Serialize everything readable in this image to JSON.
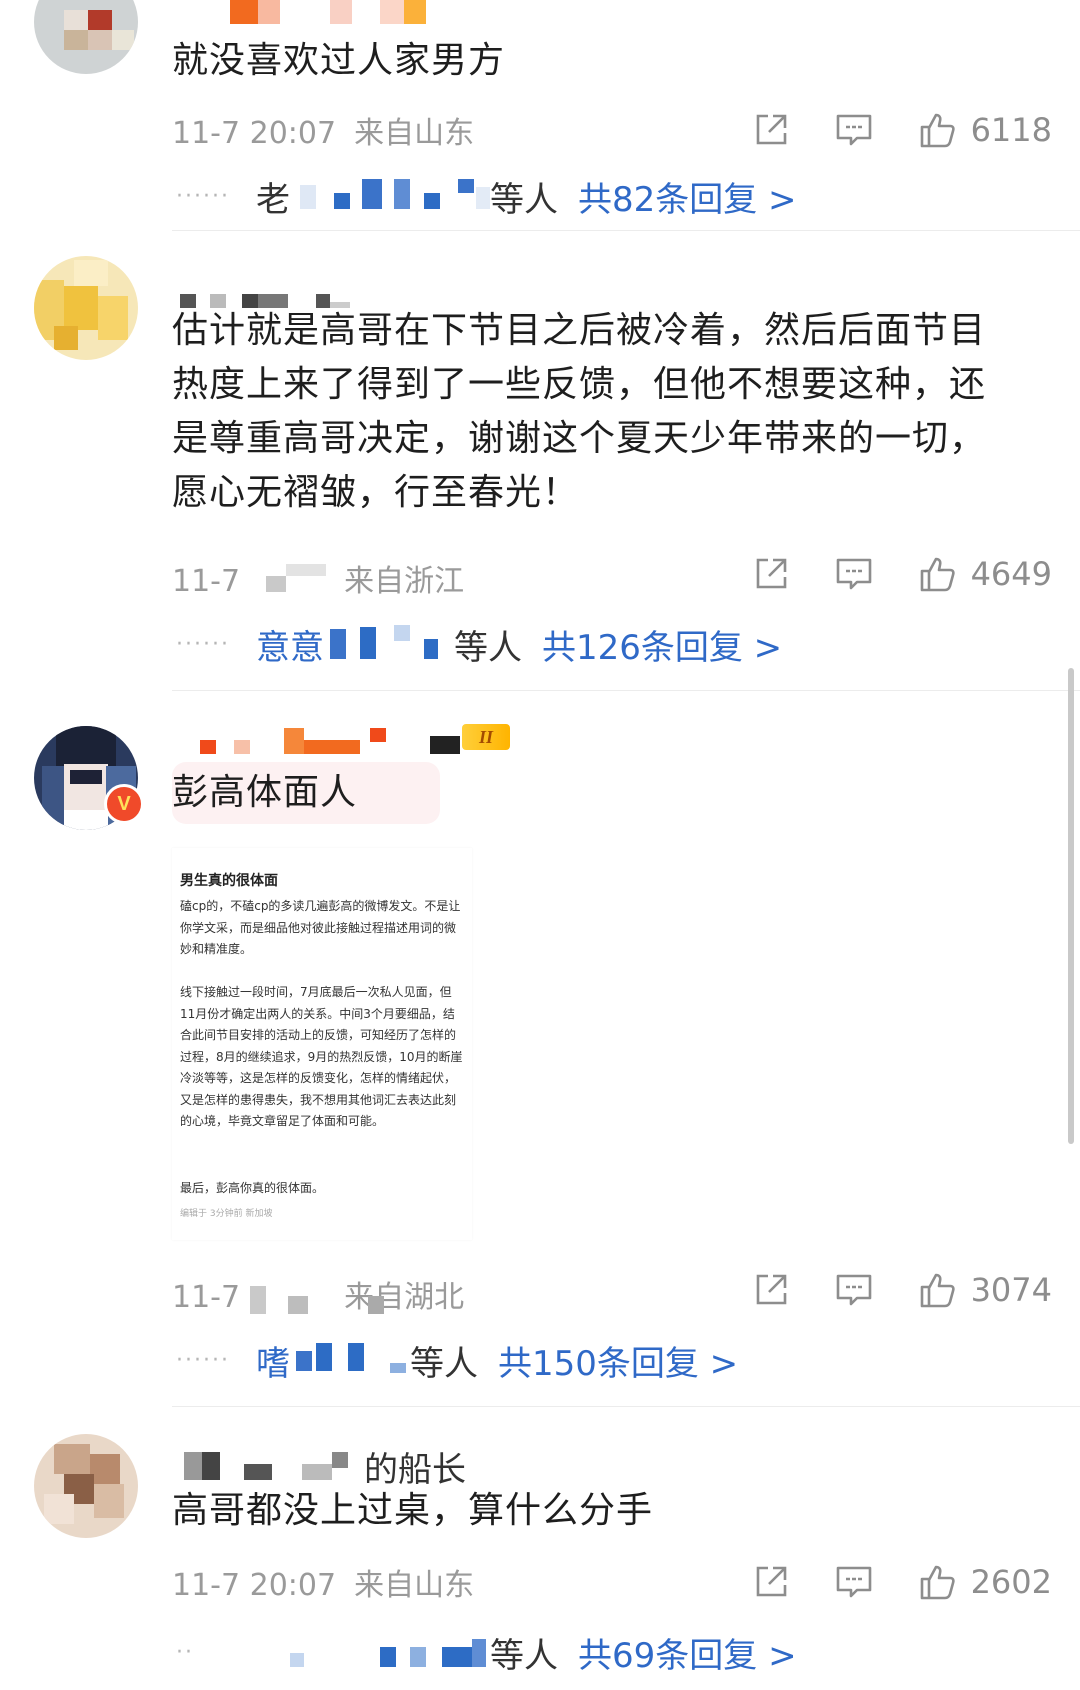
{
  "comments": [
    {
      "username": "",
      "text": "就没喜欢过人家男方",
      "time": "11-7 20:07",
      "location": "来自山东",
      "likes": "6118",
      "replies_prefix": "老",
      "replies_suffix": "等人",
      "replies_total": "共82条回复 >"
    },
    {
      "username": "",
      "text": "估计就是高哥在下节目之后被冷着，然后后面节目热度上来了得到了一些反馈，但他不想要这种，还是尊重高哥决定，谢谢这个夏天少年带来的一切，愿心无褶皱，行至春光！",
      "time": "11-7",
      "location": "来自浙江",
      "likes": "4649",
      "replies_prefix": "意意",
      "replies_suffix": "等人",
      "replies_total": "共126条回复 >"
    },
    {
      "username": "",
      "level_badge": "II",
      "verified_badge": "V",
      "text": "彭高体面人",
      "time": "11-7",
      "location": "来自湖北",
      "likes": "3074",
      "replies_prefix": "嗜",
      "replies_suffix": "等人",
      "replies_total": "共150条回复 >",
      "image": {
        "title": "男生真的很体面",
        "para1": "磕cp的，不磕cp的多读几遍彭高的微博发文。不是让你学文采，而是细品他对彼此接触过程描述用词的微妙和精准度。",
        "para2": "线下接触过一段时间，7月底最后一次私人见面，但11月份才确定出两人的关系。中间3个月要细品，结合此间节目安排的活动上的反馈，可知经历了怎样的过程，8月的继续追求，9月的热烈反馈，10月的断崖冷淡等等，这是怎样的反馈变化，怎样的情绪起伏，又是怎样的患得患失，我不想用其他词汇去表达此刻的心境，毕竟文章留足了体面和可能。",
        "para3": "最后，彭高你真的很体面。",
        "edited": "编辑于 3分钟前 新加坡"
      }
    },
    {
      "username": "的船长",
      "text": "高哥都没上过桌，算什么分手",
      "time": "11-7 20:07",
      "location": "来自山东",
      "likes": "2602",
      "replies_prefix": "",
      "replies_suffix": "等人",
      "replies_total": "共69条回复 >"
    }
  ],
  "icons": {
    "share": "share-icon",
    "comment": "comment-icon",
    "like": "thumbs-up-icon"
  },
  "colors": {
    "link_blue": "#2f69c7",
    "meta_gray": "#9a9a9a"
  }
}
